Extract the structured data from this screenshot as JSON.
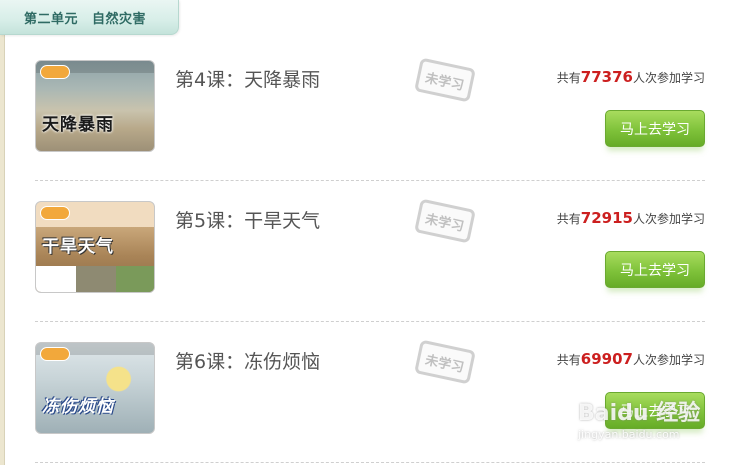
{
  "section": {
    "unit": "第二单元",
    "name": "自然灾害"
  },
  "stamp_label": "未学习",
  "lessons": [
    {
      "title": "第4课：天降暴雨",
      "thumb_caption": "天降暴雨",
      "count_prefix": "共有",
      "count": "77376",
      "count_suffix": "人次参加学习",
      "button": "马上去学习"
    },
    {
      "title": "第5课：干旱天气",
      "thumb_caption": "干旱天气",
      "count_prefix": "共有",
      "count": "72915",
      "count_suffix": "人次参加学习",
      "button": "马上去学习"
    },
    {
      "title": "第6课：冻伤烦恼",
      "thumb_caption": "冻伤烦恼",
      "count_prefix": "共有",
      "count": "69907",
      "count_suffix": "人次参加学习",
      "button": "马上去学习"
    }
  ],
  "watermark": {
    "brand": "Baidu 经验",
    "url": "jingyan.baidu.com"
  },
  "colors": {
    "count_red": "#cc1f1f",
    "button_green": "#7fc23a",
    "tab_text": "#2f6b64"
  }
}
